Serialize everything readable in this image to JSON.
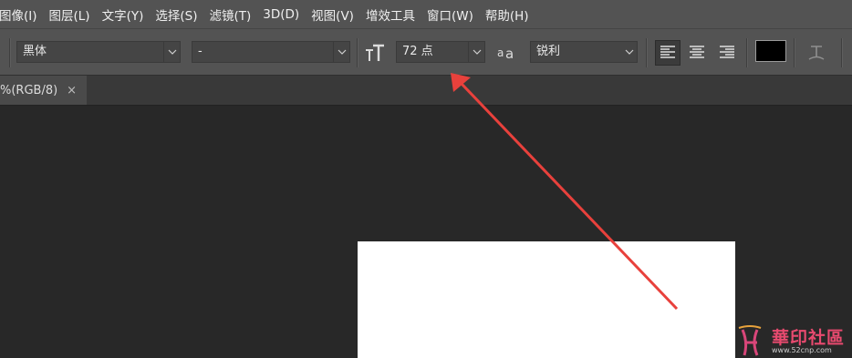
{
  "menu": [
    "图像(I)",
    "图层(L)",
    "文字(Y)",
    "选择(S)",
    "滤镜(T)",
    "3D(D)",
    "视图(V)",
    "增效工具",
    "窗口(W)",
    "帮助(H)"
  ],
  "options": {
    "font_family": "黑体",
    "font_style": "-",
    "font_size": "72 点",
    "antialias": "锐利",
    "color": "#000000"
  },
  "tab": {
    "title": "%(RGB/8)",
    "close": "×"
  },
  "watermark": {
    "text": "華印社區",
    "url": "www.52cnp.com"
  },
  "colors": {
    "arrow": "#e8413c",
    "panel": "#535353",
    "canvas": "#282828"
  }
}
